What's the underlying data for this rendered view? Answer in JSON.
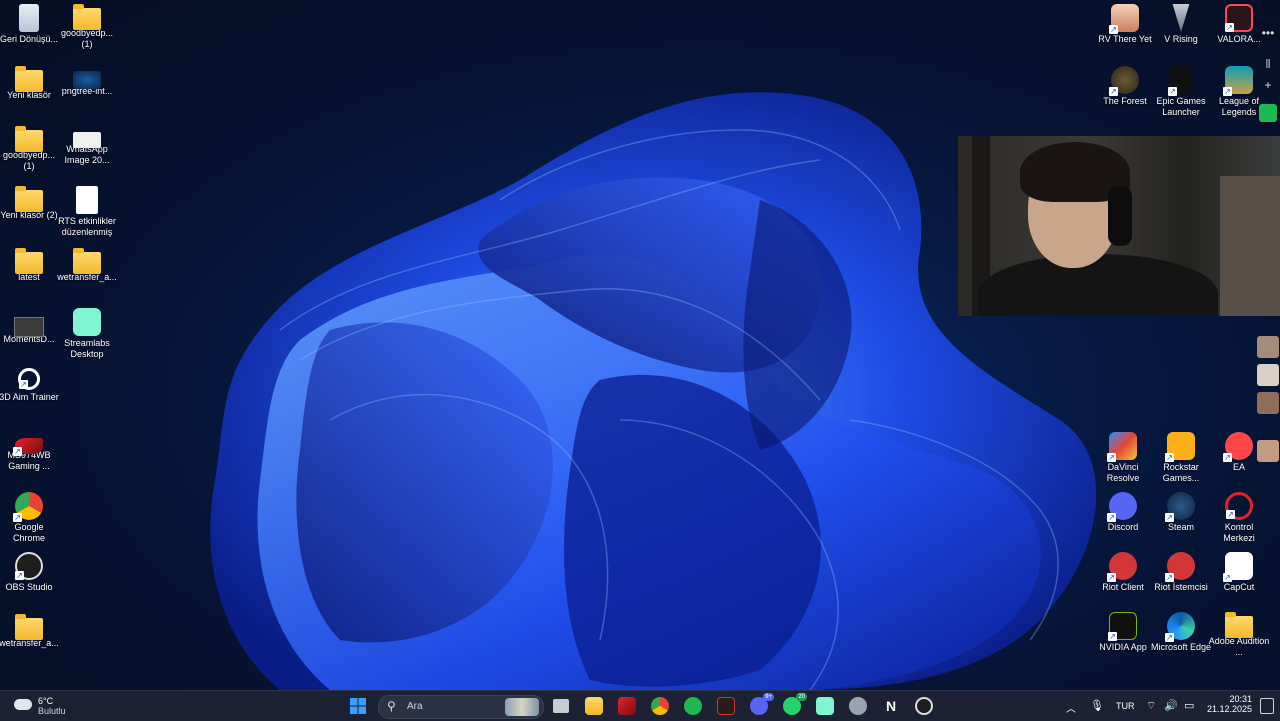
{
  "desktop": {
    "left_col1": [
      {
        "label": "Geri Dönüşü...",
        "icon": "recycle-bin-icon"
      },
      {
        "label": "Yeni klasör",
        "icon": "folder-icon"
      },
      {
        "label": "goodbyedp... (1)",
        "icon": "folder-icon"
      },
      {
        "label": "Yeni klasör (2)",
        "icon": "folder-icon"
      },
      {
        "label": "latest",
        "icon": "folder-icon"
      },
      {
        "label": "MomentsD...",
        "icon": "image-thumb-icon"
      },
      {
        "label": "3D Aim Trainer",
        "icon": "aim-trainer-icon"
      },
      {
        "label": "MS974WB Gaming ...",
        "icon": "msi-icon"
      },
      {
        "label": "Google Chrome",
        "icon": "chrome-icon"
      },
      {
        "label": "OBS Studio",
        "icon": "obs-icon"
      },
      {
        "label": "wetransfer_a...",
        "icon": "folder-icon"
      }
    ],
    "left_col2": [
      {
        "label": "goodbyedp... (1)",
        "icon": "folder-icon"
      },
      {
        "label": "pngtree-int...",
        "icon": "image-file-icon"
      },
      {
        "label": "WhatsApp Image 20...",
        "icon": "image-file-icon"
      },
      {
        "label": "RTS etkinlikler düzenlenmiş",
        "icon": "chrome-doc-icon"
      },
      {
        "label": "wetransfer_a...",
        "icon": "folder-icon"
      },
      {
        "label": "Streamlabs Desktop",
        "icon": "streamlabs-icon"
      }
    ],
    "right_top": [
      {
        "label": "RV There Yet",
        "icon": "rv-there-yet-icon"
      },
      {
        "label": "V Rising",
        "icon": "v-rising-icon"
      },
      {
        "label": "VALORA...",
        "icon": "valorant-icon"
      },
      {
        "label": "The Forest",
        "icon": "the-forest-icon"
      },
      {
        "label": "Epic Games Launcher",
        "icon": "epic-games-icon"
      },
      {
        "label": "League of Legends",
        "icon": "league-icon"
      }
    ],
    "right_bottom": [
      {
        "label": "DaVinci Resolve",
        "icon": "davinci-icon"
      },
      {
        "label": "Rockstar Games...",
        "icon": "rockstar-icon"
      },
      {
        "label": "EA",
        "icon": "ea-icon"
      },
      {
        "label": "Discord",
        "icon": "discord-icon"
      },
      {
        "label": "Steam",
        "icon": "steam-icon"
      },
      {
        "label": "Kontrol Merkezi",
        "icon": "kontrol-merkezi-icon"
      },
      {
        "label": "Riot Client",
        "icon": "riot-client-icon"
      },
      {
        "label": "Riot İstemcisi",
        "icon": "riot-istemcisi-icon"
      },
      {
        "label": "CapCut",
        "icon": "capcut-icon"
      },
      {
        "label": "NVIDIA App",
        "icon": "nvidia-icon"
      },
      {
        "label": "Microsoft Edge",
        "icon": "edge-icon"
      },
      {
        "label": "Adobe Audition ...",
        "icon": "audition-icon"
      }
    ]
  },
  "taskbar": {
    "weather_temp": "6°C",
    "weather_desc": "Bulutlu",
    "search_placeholder": "Ara",
    "discord_badge": "9+",
    "whatsapp_badge": "20",
    "language": "TUR",
    "time": "20:31",
    "date": "21.12.2025"
  },
  "side_panel": {
    "more_label": "•••"
  },
  "colors": {
    "accent": "#1a4fd6",
    "taskbar_bg": "#1c2233",
    "wallpaper_blue": "#1e4bff"
  }
}
